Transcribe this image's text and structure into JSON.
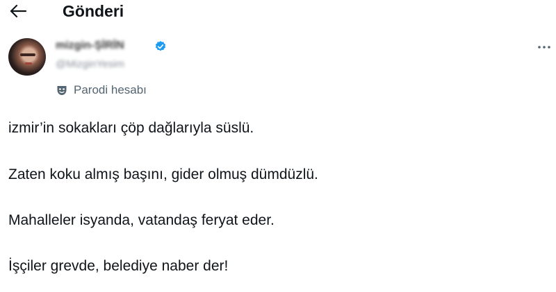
{
  "header": {
    "title": "Gönderi"
  },
  "post": {
    "author_name": "mizgin-ŞİRİN",
    "author_handle": "@MizginYesim",
    "parody_label": "Parodi hesabı",
    "lines": [
      "izmir’in sokakları çöp dağlarıyla süslü.",
      "Zaten koku almış başını, gider olmuş dümdüzlü.",
      "Mahalleler isyanda, vatandaş feryat eder.",
      "İşçiler grevde, belediye naber der!"
    ]
  },
  "icons": {
    "back": "back-arrow-icon",
    "verified": "verified-badge-icon",
    "more": "more-options-icon",
    "parody": "theater-mask-icon"
  },
  "colors": {
    "accent": "#1d9bf0",
    "text": "#0f1419",
    "secondary_text": "#536471"
  }
}
